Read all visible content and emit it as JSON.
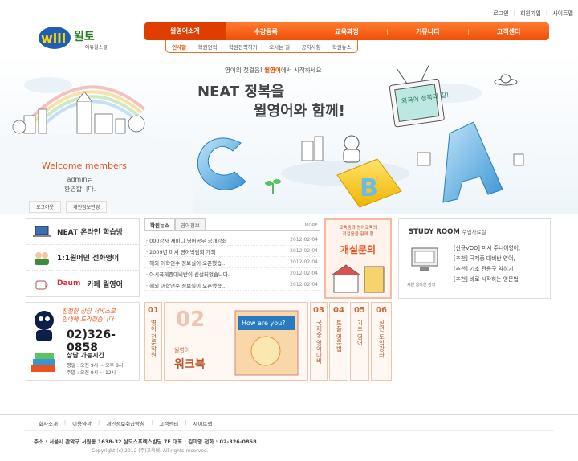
{
  "top_links": [
    "로그인",
    "회원가입",
    "사이트맵"
  ],
  "logo": {
    "brand_en": "will",
    "brand_ko": "윌토",
    "sub": "에듀윌스쿨"
  },
  "nav": [
    "윌영어소개",
    "수강등록",
    "교육과정",
    "커뮤니티",
    "고객센터"
  ],
  "subnav": [
    "인사말",
    "학원연혁",
    "학원전략하기",
    "오시는 길",
    "공지사항",
    "학원뉴스"
  ],
  "hero": {
    "tag_pre": "영어의 첫걸음! ",
    "tag_brand": "윌영어",
    "tag_post": "에서 시작하세요",
    "line1": "NEAT 정복을",
    "line2": "윌영어와 함께!",
    "tv_text": "외국어 정복의 길!"
  },
  "welcome": {
    "title": "Welcome members",
    "user": "admin님",
    "msg": "환영합니다.",
    "logout": "로그아웃",
    "profile": "개인정보변경"
  },
  "left_menu": [
    "NEAT 온라인 학습방",
    "1:1원어민 전화영어",
    "카페 윌영어"
  ],
  "left_menu_cafe_brand": "Daum",
  "phone": {
    "slogan1": "친절한 상담 서비스로",
    "slogan2": "안내해 드리겠습니다",
    "number": "02)326-0858",
    "hours_title": "상담 가능시간",
    "weekday": "평일 : 오전 9시 ~ 오후 8시",
    "weekend": "주말 : 오전 9시 ~ 12시"
  },
  "news": {
    "tabs": [
      "학원뉴스",
      "영어정보"
    ],
    "more": "MORE",
    "items": [
      {
        "t": "000강사 재미니 영어공부 공개강좌",
        "d": "2012-02-04"
      },
      {
        "t": "2009년 미서 영어박람회 개최",
        "d": "2012-02-04"
      },
      {
        "t": "해외 어학연수 정보실이 오픈했습...",
        "d": "2012-02-04"
      },
      {
        "t": "아시국제중대비반이 신설되었습니다.",
        "d": "2012-02-04"
      },
      {
        "t": "해외 어학연수 정보실이 오픈했습...",
        "d": "2012-02-04"
      }
    ]
  },
  "counsel": {
    "line1": "교육생과 영어교육의",
    "line2": "첫걸음을 함께 할",
    "title": "개설문의"
  },
  "study": {
    "title": "STUDY ROOM",
    "sub": "수업자료실",
    "caption": "세븐 올라운 강의",
    "items": [
      "[신규VOD] 미시 주니어영어,",
      "[추천] 국제중 대비반 영어,",
      "[추천] 기초 관용구 익히기",
      "[추천] 바로 시작하는 영문법"
    ]
  },
  "cards": [
    {
      "n": "01",
      "label": "영어 전문학원"
    },
    {
      "n": "02",
      "label": "윌영어",
      "big": "워크북",
      "book": "How are you?"
    },
    {
      "n": "03",
      "label": "국제중 영어대비"
    },
    {
      "n": "04",
      "label": "토플 영문법"
    },
    {
      "n": "05",
      "label": "기초 영어"
    },
    {
      "n": "06",
      "label": "실전 토익강좌"
    }
  ],
  "footer": {
    "links": [
      "회사소개",
      "이용약관",
      "개인정보취급방침",
      "고객센터",
      "사이트맵"
    ],
    "address": "주소 : 서울시 관악구 서원동 1638-32 삼모스포렉스빌딩 7F   대표 : 김미영   전화 : 02-326-0858",
    "copyright": "Copyright (c) 2012 (주)교육넷. All rights reserved."
  },
  "colors": {
    "accent": "#f04e07",
    "welcome": "#e8541c"
  }
}
